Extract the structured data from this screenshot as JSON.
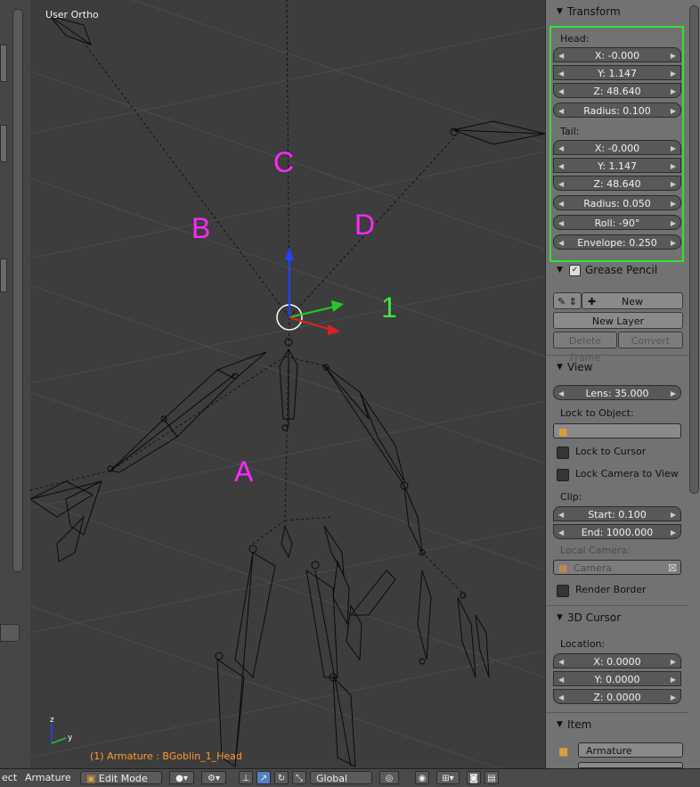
{
  "viewport": {
    "view_label": "User Ortho",
    "status_label": "(1) Armature : BGoblin_1_Head",
    "annotations": {
      "a": "A",
      "b": "B",
      "c": "C",
      "d": "D",
      "one": "1"
    },
    "annotation_colors": {
      "letters": "#ff28ff",
      "number": "#3ee63e"
    },
    "axis_colors": {
      "x": "#e02020",
      "y": "#22cc22",
      "z": "#2244ff"
    },
    "mini_axes": {
      "y_label": "y",
      "z_label": "z"
    }
  },
  "panel": {
    "transform": {
      "title": "Transform",
      "head_label": "Head:",
      "head": {
        "x": "X: -0.000",
        "y": "Y: 1.147",
        "z": "Z: 48.640",
        "radius": "Radius: 0.100"
      },
      "tail_label": "Tail:",
      "tail": {
        "x": "X: -0.000",
        "y": "Y: 1.147",
        "z": "Z: 48.640",
        "radius": "Radius: 0.050"
      },
      "roll": "Roll: -90°",
      "envelope": "Envelope: 0.250"
    },
    "grease_pencil": {
      "title": "Grease Pencil",
      "new_label": "New",
      "new_layer_label": "New Layer",
      "delete_frame_label": "Delete Frame",
      "convert_label": "Convert"
    },
    "view": {
      "title": "View",
      "lens": "Lens: 35.000",
      "lock_to_object_label": "Lock to Object:",
      "lock_to_cursor": "Lock to Cursor",
      "lock_camera_to_view": "Lock Camera to View",
      "clip_label": "Clip:",
      "clip_start": "Start: 0.100",
      "clip_end": "End: 1000.000",
      "local_camera_label": "Local Camera:",
      "local_camera_value": "Camera",
      "render_border": "Render Border"
    },
    "cursor": {
      "title": "3D Cursor",
      "location_label": "Location:",
      "x": "X: 0.0000",
      "y": "Y: 0.0000",
      "z": "Z: 0.0000"
    },
    "item": {
      "title": "Item",
      "name": "Armature"
    }
  },
  "bottom_bar": {
    "left_fragment": "ect",
    "armature_fragment": "Armature",
    "mode": "Edit Mode",
    "orientation": "Global"
  },
  "colors": {
    "highlight_box": "#33e233",
    "status_text": "#ff9a2a",
    "active_button": "#5680c2"
  }
}
